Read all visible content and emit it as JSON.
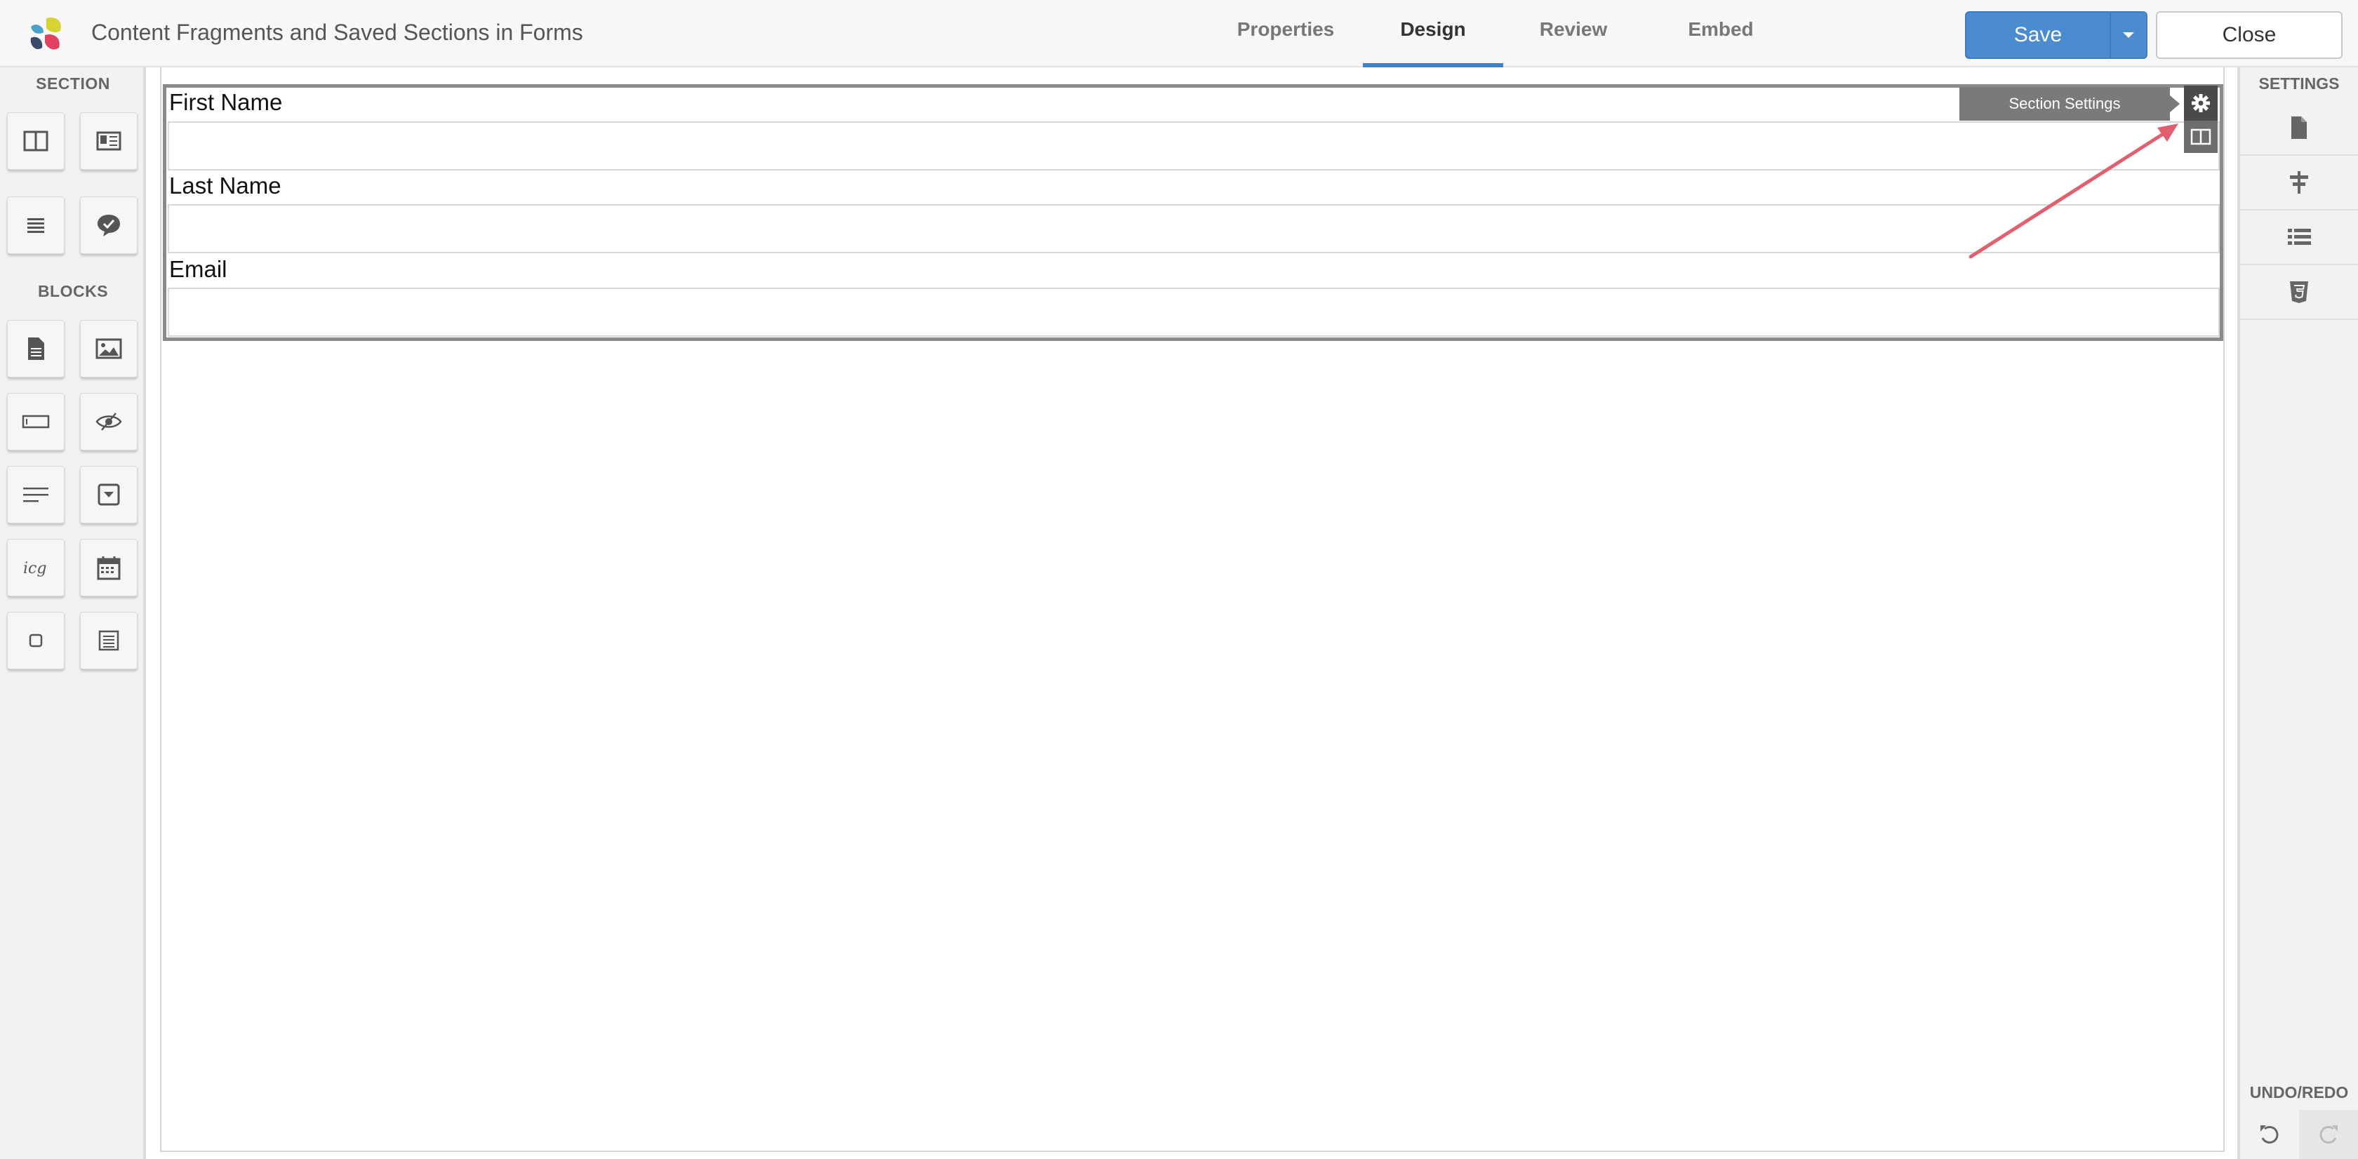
{
  "header": {
    "title": "Content Fragments and Saved Sections in Forms",
    "tabs": [
      {
        "label": "Properties",
        "active": false
      },
      {
        "label": "Design",
        "active": true
      },
      {
        "label": "Review",
        "active": false
      },
      {
        "label": "Embed",
        "active": false
      }
    ],
    "save_label": "Save",
    "close_label": "Close"
  },
  "left_sidebar": {
    "section_heading": "SECTION",
    "section_tools": [
      "two-column-section-icon",
      "sidebar-section-icon",
      "list-section-icon",
      "feedback-section-icon"
    ],
    "blocks_heading": "BLOCKS",
    "block_tools": [
      "text-document-icon",
      "image-icon",
      "text-field-icon",
      "hidden-field-icon",
      "paragraph-text-icon",
      "dropdown-icon",
      "signature-icon",
      "calendar-icon",
      "checkbox-icon",
      "form-list-icon"
    ]
  },
  "canvas": {
    "fields": [
      {
        "label": "First Name",
        "value": ""
      },
      {
        "label": "Last Name",
        "value": ""
      },
      {
        "label": "Email",
        "value": ""
      }
    ],
    "section_settings_tooltip": "Section Settings"
  },
  "right_sidebar": {
    "settings_heading": "SETTINGS",
    "items": [
      "page-icon",
      "alignment-icon",
      "list-icon",
      "css3-icon"
    ],
    "undo_heading": "UNDO/REDO"
  },
  "colors": {
    "accent": "#3d82c4",
    "save_button": "#4a8ccf",
    "annotation_arrow": "#e06070"
  }
}
